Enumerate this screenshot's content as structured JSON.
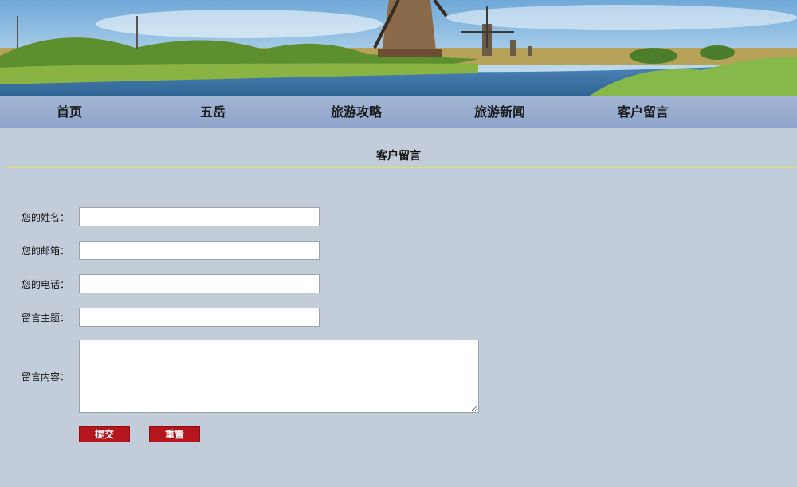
{
  "nav": {
    "items": [
      {
        "label": "首页"
      },
      {
        "label": "五岳"
      },
      {
        "label": "旅游攻略"
      },
      {
        "label": "旅游新闻"
      },
      {
        "label": "客户留言"
      }
    ]
  },
  "section": {
    "title": "客户留言"
  },
  "form": {
    "name_label": "您的姓名：",
    "email_label": "您的邮箱：",
    "phone_label": "您的电话：",
    "subject_label": "留言主题：",
    "content_label": "留言内容：",
    "name_value": "",
    "email_value": "",
    "phone_value": "",
    "subject_value": "",
    "content_value": "",
    "submit_label": "提交",
    "reset_label": "重置"
  },
  "colors": {
    "page_bg": "#c3cdd9",
    "nav_bg": "#8ea5cb",
    "button_bg": "#b5161d",
    "divider": "#e3e05a"
  }
}
